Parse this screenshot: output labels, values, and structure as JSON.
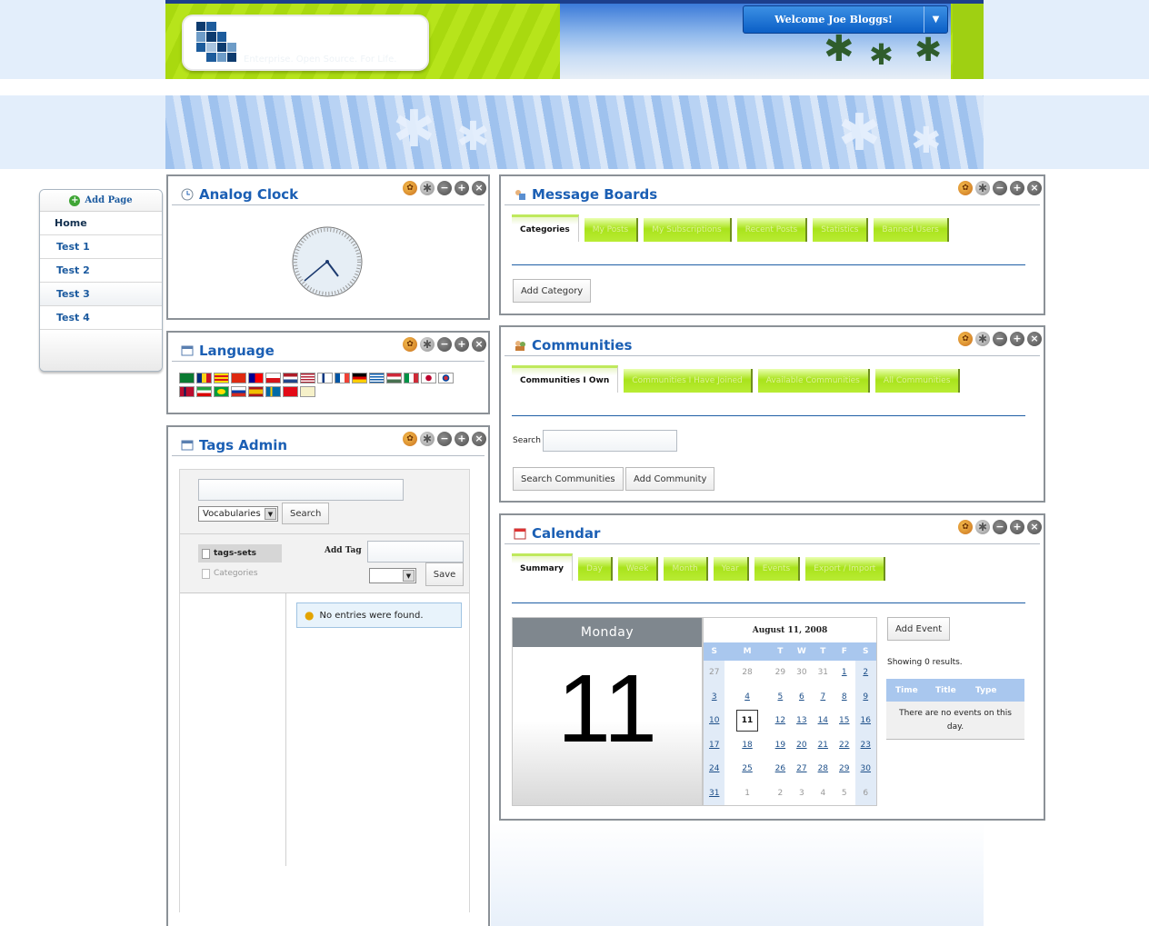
{
  "header": {
    "logo_tagline": "Enterprise. Open Source. For Life.",
    "welcome_text": "Welcome Joe Bloggs!",
    "welcome_menu_glyph": "▼"
  },
  "nav": {
    "add_page": "Add Page",
    "items": [
      {
        "label": "Home"
      },
      {
        "label": "Test 1"
      },
      {
        "label": "Test 2"
      },
      {
        "label": "Test 3"
      },
      {
        "label": "Test 4"
      }
    ]
  },
  "portlets": {
    "clock": {
      "title": "Analog Clock"
    },
    "language": {
      "title": "Language"
    },
    "tags": {
      "title": "Tags Admin",
      "vocab_select": "Vocabularies",
      "search_btn": "Search",
      "tag_sets": "tags-sets",
      "categories": "Categories",
      "add_tag_label": "Add Tag",
      "save_btn": "Save",
      "empty_msg": "No entries were found."
    },
    "message_boards": {
      "title": "Message Boards",
      "tabs": [
        "Categories",
        "My Posts",
        "My Subscriptions",
        "Recent Posts",
        "Statistics",
        "Banned Users"
      ],
      "add_category": "Add Category"
    },
    "communities": {
      "title": "Communities",
      "tabs": [
        "Communities I Own",
        "Communities I Have Joined",
        "Available Communities",
        "All Communities"
      ],
      "search_label": "Search",
      "search_btn": "Search Communities",
      "add_btn": "Add Community"
    },
    "calendar": {
      "title": "Calendar",
      "tabs": [
        "Summary",
        "Day",
        "Week",
        "Month",
        "Year",
        "Events",
        "Export / Import"
      ],
      "day_name": "Monday",
      "day_number": "11",
      "month_label": "August 11, 2008",
      "weekdays": [
        "S",
        "M",
        "T",
        "W",
        "T",
        "F",
        "S"
      ],
      "weeks": [
        [
          "27",
          "28",
          "29",
          "30",
          "31",
          "1",
          "2"
        ],
        [
          "3",
          "4",
          "5",
          "6",
          "7",
          "8",
          "9"
        ],
        [
          "10",
          "11",
          "12",
          "13",
          "14",
          "15",
          "16"
        ],
        [
          "17",
          "18",
          "19",
          "20",
          "21",
          "22",
          "23"
        ],
        [
          "24",
          "25",
          "26",
          "27",
          "28",
          "29",
          "30"
        ],
        [
          "31",
          "1",
          "2",
          "3",
          "4",
          "5",
          "6"
        ]
      ],
      "add_event": "Add Event",
      "results_text": "Showing 0 results.",
      "col_time": "Time",
      "col_title": "Title",
      "col_type": "Type",
      "no_events": "There are no events on this day."
    }
  },
  "colors": {
    "accent": "#1b5fb4",
    "header_green": "#a9d90f",
    "tab_green": "#a9e31b",
    "nav_text": "#1b5a9f"
  }
}
